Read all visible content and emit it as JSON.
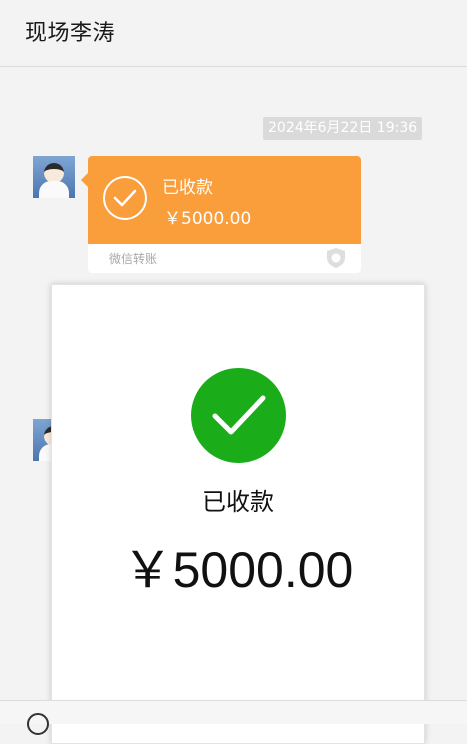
{
  "header": {
    "title": "现场李涛"
  },
  "chat": {
    "timestamp": "2024年6月22日 19:36",
    "transfer_card": {
      "status": "已收款",
      "amount": "￥5000.00",
      "footer_label": "微信转账",
      "accent_color": "#fa9d3b"
    }
  },
  "detail_panel": {
    "status": "已收款",
    "amount": "￥5000.00",
    "check_color": "#1aad19",
    "icon": "check-icon"
  },
  "bottom_bar": {
    "icon": "emoji-icon"
  }
}
